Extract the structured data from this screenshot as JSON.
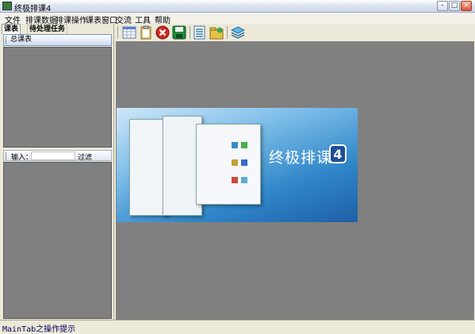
{
  "window": {
    "title": "终极排课4"
  },
  "menu": [
    "文件",
    "排课数据",
    "排课操作",
    "课表窗口",
    "交流",
    "工具",
    "帮助"
  ],
  "left_panel": {
    "tabs": [
      "课表",
      "待处理任务"
    ],
    "kebiao_header": "总课表",
    "filter": {
      "label": "输入：",
      "value": "",
      "button": "过滤"
    }
  },
  "toolbar": {
    "icons": [
      "calendar-grid-icon",
      "clipboard-icon",
      "stop-icon",
      "save-icon",
      "list-icon",
      "folder-star-icon",
      "layers-icon"
    ]
  },
  "splash": {
    "title": "终极排课",
    "badge": "4"
  },
  "status": {
    "text": "MainTab之操作提示"
  },
  "colors": {
    "workspace": "#808080",
    "title_gradient_end": "#cfd8e8",
    "stop_red": "#d0281e",
    "save_green": "#1e8a3a"
  }
}
